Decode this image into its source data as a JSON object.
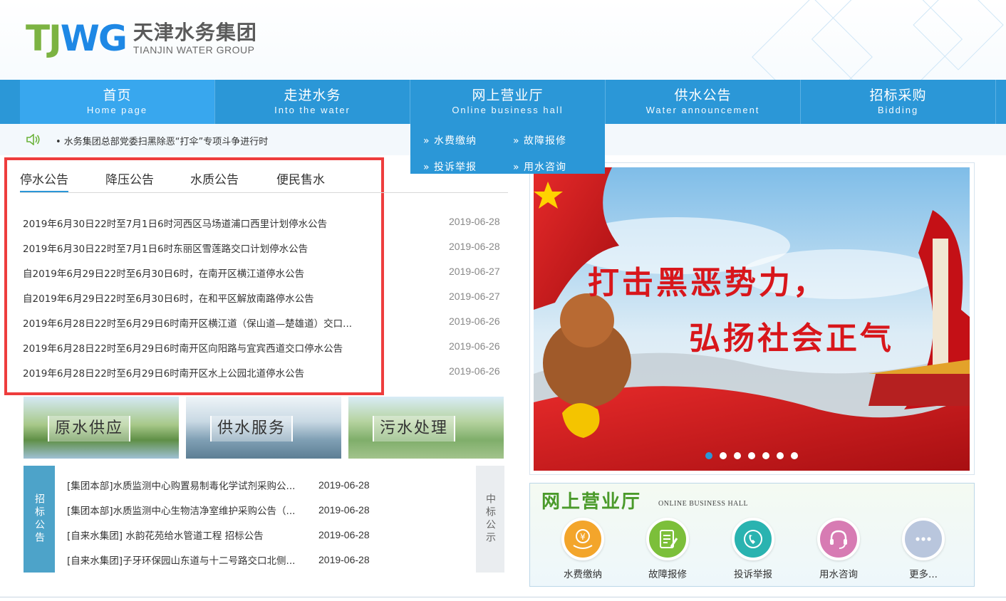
{
  "header": {
    "logo_mark_1": "TJ",
    "logo_mark_2": "WG",
    "logo_cn": "天津水务集团",
    "logo_en": "TIANJIN WATER GROUP"
  },
  "nav": [
    {
      "cn": "首页",
      "en": "Home page"
    },
    {
      "cn": "走进水务",
      "en": "Into the water"
    },
    {
      "cn": "网上营业厅",
      "en": "Online business hall"
    },
    {
      "cn": "供水公告",
      "en": "Water announcement"
    },
    {
      "cn": "招标采购",
      "en": "Bidding"
    }
  ],
  "dropdown": [
    "水费缴纳",
    "故障报修",
    "投诉举报",
    "用水咨询"
  ],
  "notice": {
    "text": "• 水务集团总部党委扫黑除恶“打伞”专项斗争进行时"
  },
  "tabs": [
    "停水公告",
    "降压公告",
    "水质公告",
    "便民售水"
  ],
  "news": [
    {
      "title": "2019年6月30日22时至7月1日6时河西区马场道浦口西里计划停水公告",
      "date": "2019-06-28"
    },
    {
      "title": "2019年6月30日22时至7月1日6时东丽区雪莲路交口计划停水公告",
      "date": "2019-06-28"
    },
    {
      "title": "自2019年6月29日22时至6月30日6时，在南开区横江道停水公告",
      "date": "2019-06-27"
    },
    {
      "title": "自2019年6月29日22时至6月30日6时，在和平区解放南路停水公告",
      "date": "2019-06-27"
    },
    {
      "title": "2019年6月28日22时至6月29日6时南开区横江道（保山道—楚雄道）交口...",
      "date": "2019-06-26"
    },
    {
      "title": "2019年6月28日22时至6月29日6时南开区向阳路与宜宾西道交口停水公告",
      "date": "2019-06-26"
    },
    {
      "title": "2019年6月28日22时至6月29日6时南开区水上公园北道停水公告",
      "date": "2019-06-26"
    }
  ],
  "thumbs": [
    "原水供应",
    "供水服务",
    "污水处理"
  ],
  "bidding": {
    "side": "招标公告",
    "win_side": "中标公示",
    "items": [
      {
        "title": "[集团本部]水质监测中心购置易制毒化学试剂采购公...",
        "date": "2019-06-28"
      },
      {
        "title": "[集团本部]水质监测中心生物洁净室维护采购公告（...",
        "date": "2019-06-28"
      },
      {
        "title": "[自来水集团] 水韵花苑给水管道工程 招标公告",
        "date": "2019-06-28"
      },
      {
        "title": "[自来水集团]子牙环保园山东道与十二号路交口北侧...",
        "date": "2019-06-28"
      }
    ]
  },
  "banner": {
    "line1": "打击黑恶势力，",
    "line2": "弘扬社会正气"
  },
  "hall": {
    "title": "网上营业厅",
    "en": "ONLINE BUSINESS HALL",
    "services": [
      {
        "label": "水费缴纳",
        "icon": "yuan-hand-icon",
        "color": "#f3a52b"
      },
      {
        "label": "故障报修",
        "icon": "repair-form-icon",
        "color": "#7cbf3a"
      },
      {
        "label": "投诉举报",
        "icon": "phone-complaint-icon",
        "color": "#2ab3b0"
      },
      {
        "label": "用水咨询",
        "icon": "headset-icon",
        "color": "#d77bb3"
      },
      {
        "label": "更多...",
        "icon": "more-icon",
        "color": "#b9c6dd"
      }
    ]
  },
  "colors": {
    "nav": "#2b97d7",
    "highlight": "#ee3d3d"
  }
}
